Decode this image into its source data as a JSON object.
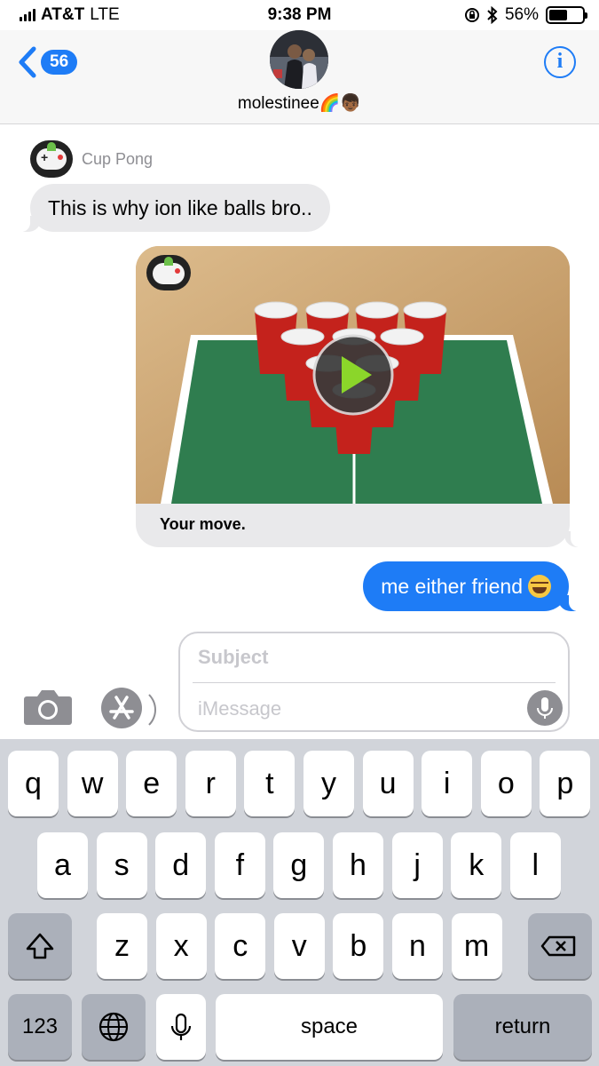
{
  "status_bar": {
    "carrier": "AT&T",
    "network": "LTE",
    "time": "9:38 PM",
    "battery_percent": "56%",
    "battery_level": 0.56,
    "icons": [
      "signal-icon",
      "rotation-lock-icon",
      "bluetooth-icon",
      "battery-icon"
    ]
  },
  "header": {
    "back_badge": "56",
    "contact_name": "molestinee🌈👦🏾",
    "info_label": "i"
  },
  "messages": {
    "app_name": "Cup Pong",
    "incoming_text": "This is why ion like balls bro..",
    "game_caption": "Your move.",
    "outgoing_text": "me either friend"
  },
  "compose": {
    "subject_placeholder": "Subject",
    "message_placeholder": "iMessage"
  },
  "keyboard": {
    "row1": [
      "q",
      "w",
      "e",
      "r",
      "t",
      "y",
      "u",
      "i",
      "o",
      "p"
    ],
    "row2": [
      "a",
      "s",
      "d",
      "f",
      "g",
      "h",
      "j",
      "k",
      "l"
    ],
    "row3": [
      "z",
      "x",
      "c",
      "v",
      "b",
      "n",
      "m"
    ],
    "numbers_key": "123",
    "space_key": "space",
    "return_key": "return"
  },
  "colors": {
    "accent_blue": "#1e7cf6",
    "incoming_bubble": "#e9e9eb",
    "keyboard_bg": "#d1d4da",
    "table_green": "#2f7d4f",
    "cup_red": "#c4221c"
  }
}
